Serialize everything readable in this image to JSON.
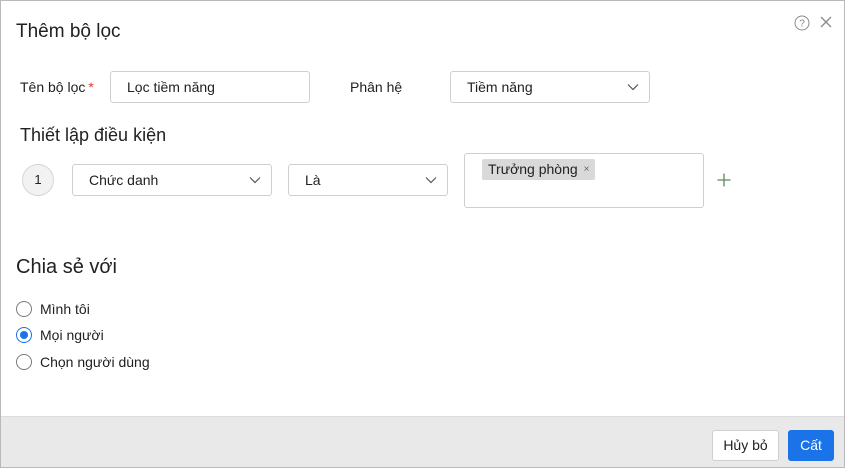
{
  "dialog": {
    "title": "Thêm bộ lọc",
    "help_icon": "question-circle-icon",
    "close_icon": "close-icon"
  },
  "form": {
    "name_label": "Tên bộ lọc",
    "required_mark": "*",
    "name_value": "Lọc tiềm năng",
    "module_label": "Phân hệ",
    "module_value": "Tiềm năng"
  },
  "conditions": {
    "title": "Thiết lập điều kiện",
    "rows": [
      {
        "index": "1",
        "field": "Chức danh",
        "operator": "Là",
        "values": [
          "Trưởng phòng"
        ],
        "remove_tag_glyph": "×"
      }
    ],
    "add_icon": "plus-icon"
  },
  "share": {
    "title": "Chia sẻ với",
    "options": [
      {
        "label": "Mình tôi",
        "checked": false
      },
      {
        "label": "Mọi người",
        "checked": true
      },
      {
        "label": "Chọn người dùng",
        "checked": false
      }
    ]
  },
  "footer": {
    "cancel_label": "Hủy bỏ",
    "save_label": "Cất"
  },
  "colors": {
    "accent": "#1a73e8",
    "required": "#e53935",
    "footer_bg": "#e9e9e9"
  }
}
